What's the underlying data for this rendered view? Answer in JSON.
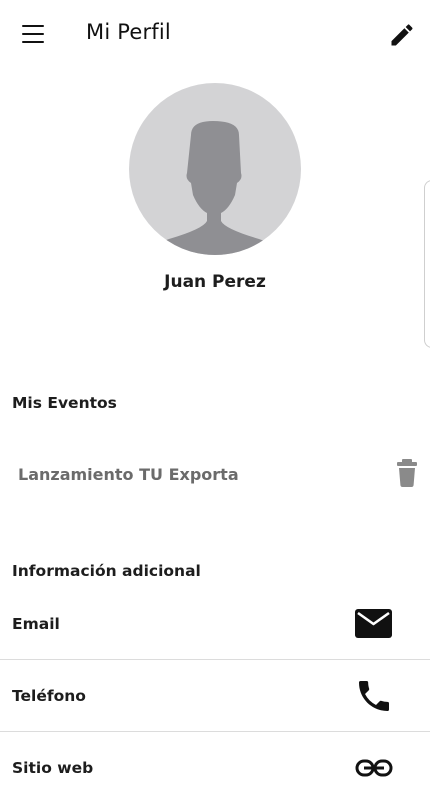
{
  "header": {
    "menu_icon": "menu-icon",
    "title": "Mi Perfil",
    "edit_icon": "pencil-icon"
  },
  "profile": {
    "avatar_icon": "default-avatar-icon",
    "name": "Juan Perez"
  },
  "events": {
    "section_title": "Mis Eventos",
    "items": [
      {
        "label": "Lanzamiento TU Exporta",
        "action_icon": "trash-icon"
      }
    ]
  },
  "additional_info": {
    "section_title": "Información adicional",
    "rows": [
      {
        "label": "Email",
        "icon": "mail-icon"
      },
      {
        "label": "Teléfono",
        "icon": "phone-icon"
      },
      {
        "label": "Sitio web",
        "icon": "link-icon"
      }
    ]
  },
  "colors": {
    "avatar_bg": "#d3d3d5",
    "avatar_silhouette": "#8f8f93",
    "event_text": "#6b6b6b",
    "icon": "#111111"
  }
}
